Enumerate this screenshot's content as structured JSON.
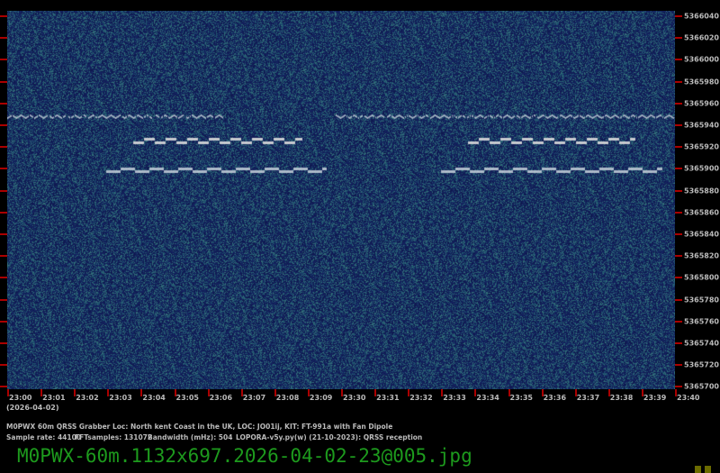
{
  "y_axis_labels": [
    "5366040",
    "5366020",
    "5366000",
    "5365980",
    "5365960",
    "5365940",
    "5365920",
    "5365900",
    "5365880",
    "5365860",
    "5365840",
    "5365820",
    "5365800",
    "5365780",
    "5365760",
    "5365740",
    "5365720",
    "5365700"
  ],
  "x_axis_labels": [
    "23:00",
    "23:01",
    "23:02",
    "23:03",
    "23:04",
    "23:05",
    "23:06",
    "23:07",
    "23:08",
    "23:09",
    "23:30",
    "23:31",
    "23:32",
    "23:33",
    "23:34",
    "23:35",
    "23:36",
    "23:37",
    "23:38",
    "23:39",
    "23:40"
  ],
  "date_label": "(2026-04-02)",
  "info_line1": "M0PWX 60m QRSS Grabber Loc: North kent Coast in the UK, LOC: JO01ij, KIT: FT-991a with Fan Dipole",
  "info_line2_sample": "Sample rate: 44100",
  "info_line2_fft": "FFTsamples: 131072",
  "info_line2_bw": "Bandwidth (mHz): 504",
  "info_line2_sw": "LOPORA-v5y.py(w) (21-10-2023): QRSS reception",
  "filename": "M0PWX-60m.1132x697.2026-04-02-23@005.jpg",
  "colors": {
    "background": "#000000",
    "noise_base": "#1a2f5e",
    "tick": "#aa0000",
    "label": "#bbbbbb",
    "filename": "#1d9a1d"
  }
}
